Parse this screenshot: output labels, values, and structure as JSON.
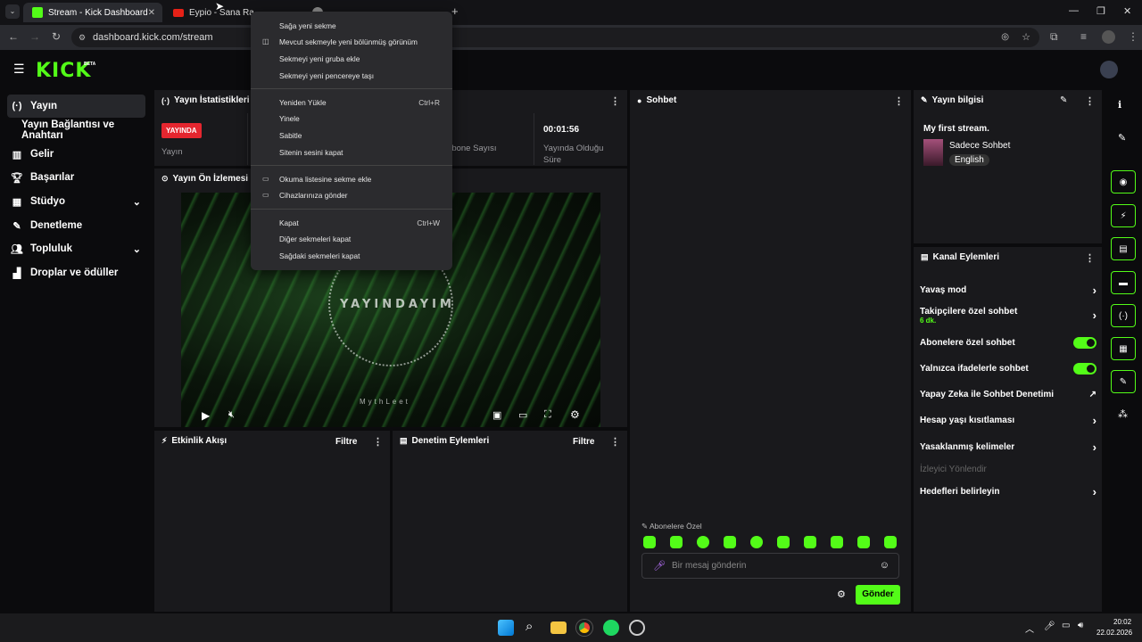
{
  "browser": {
    "tabs": [
      {
        "title": "Stream - Kick Dashboard",
        "active": true
      },
      {
        "title": "Eypio - Sana Rağmen",
        "active": false
      },
      {
        "title": "",
        "active": false
      },
      {
        "title": "",
        "active": false
      }
    ],
    "url": "dashboard.kick.com/stream"
  },
  "context_menu": {
    "items": [
      {
        "label": "Sağa yeni sekme",
        "shortcut": ""
      },
      {
        "label": "Mevcut sekmeyle yeni bölünmüş görünüm",
        "shortcut": ""
      },
      {
        "label": "Sekmeyi yeni gruba ekle",
        "shortcut": ""
      },
      {
        "label": "Sekmeyi yeni pencereye taşı",
        "shortcut": ""
      },
      {
        "label": "Yeniden Yükle",
        "shortcut": "Ctrl+R"
      },
      {
        "label": "Yinele",
        "shortcut": ""
      },
      {
        "label": "Sabitle",
        "shortcut": ""
      },
      {
        "label": "Sitenin sesini kapat",
        "shortcut": ""
      },
      {
        "label": "Okuma listesine sekme ekle",
        "shortcut": ""
      },
      {
        "label": "Cihazlarınıza gönder",
        "shortcut": ""
      },
      {
        "label": "Kapat",
        "shortcut": "Ctrl+W"
      },
      {
        "label": "Diğer sekmeleri kapat",
        "shortcut": ""
      },
      {
        "label": "Sağdaki sekmeleri kapat",
        "shortcut": ""
      }
    ]
  },
  "app": {
    "logo": "KICK",
    "beta": "BETA"
  },
  "sidebar": {
    "items": [
      {
        "label": "Yayın",
        "icon": "broadcast-icon"
      },
      {
        "label": "Yayın Bağlantısı ve Anahtarı",
        "icon": ""
      },
      {
        "label": "Gelir",
        "icon": "chart-icon"
      },
      {
        "label": "Başarılar",
        "icon": "trophy-icon"
      },
      {
        "label": "Stüdyo",
        "icon": "grid-icon"
      },
      {
        "label": "Denetleme",
        "icon": "wrench-icon"
      },
      {
        "label": "Topluluk",
        "icon": "people-icon"
      },
      {
        "label": "Droplar ve ödüller",
        "icon": "gift-icon"
      }
    ]
  },
  "stats": {
    "title": "Yayın İstatistikleri",
    "live_badge": "YAYINDA",
    "stream_label": "Yayın",
    "subs_label": "Abone Sayısı",
    "duration_value": "00:01:56",
    "duration_label": "Yayında Olduğu Süre"
  },
  "preview": {
    "title": "Yayın Ön İzlemesi",
    "watermark": "MythLeet",
    "ring_text": "YAYINDAYIM"
  },
  "activity": {
    "title": "Etkinlik Akışı",
    "filter": "Filtre"
  },
  "moderation": {
    "title": "Denetim Eylemleri",
    "filter": "Filtre"
  },
  "chat": {
    "title": "Sohbet",
    "subscribers_only": "Abonelere Özel",
    "placeholder": "Bir mesaj gönderin",
    "send": "Gönder"
  },
  "stream_info": {
    "title": "Yayın bilgisi",
    "stream_title": "My first stream.",
    "category": "Sadece Sohbet",
    "language": "English"
  },
  "channel_actions": {
    "title": "Kanal Eylemleri",
    "slow_mode": "Yavaş mod",
    "followers_chat": "Takipçilere özel sohbet",
    "followers_chat_sub": "6 dk.",
    "subscribers_chat": "Abonelere özel sohbet",
    "subscribers_chat_on": true,
    "emotes_chat": "Yalnızca ifadelerle sohbet",
    "emotes_chat_on": true,
    "ai_moderation": "Yapay Zeka ile Sohbet Denetimi",
    "account_age": "Hesap yaşı kısıtlaması",
    "banned_words": "Yasaklanmış kelimeler",
    "viewer_redirect": "İzleyici Yönlendir",
    "set_goals": "Hedefleri belirleyin"
  },
  "taskbar": {
    "time": "20:02",
    "date": "22.02.2026"
  },
  "colors": {
    "accent": "#53fc18",
    "live": "#e5262f",
    "panel": "#19191c",
    "background": "#0b0b0d"
  }
}
